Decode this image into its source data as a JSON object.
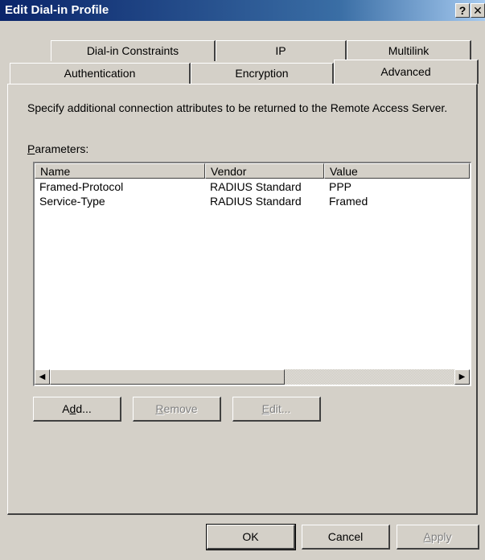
{
  "window": {
    "title": "Edit Dial-in Profile",
    "help_label": "?",
    "close_label": "✕"
  },
  "tabs": {
    "back": [
      "Dial-in Constraints",
      "IP",
      "Multilink"
    ],
    "front": [
      "Authentication",
      "Encryption",
      "Advanced"
    ],
    "active": "Advanced"
  },
  "advanced": {
    "description": "Specify additional connection attributes to be returned to the Remote Access Server.",
    "parameters_label": "Parameters:",
    "columns": {
      "name": "Name",
      "vendor": "Vendor",
      "value": "Value"
    },
    "rows": [
      {
        "name": "Framed-Protocol",
        "vendor": "RADIUS Standard",
        "value": "PPP"
      },
      {
        "name": "Service-Type",
        "vendor": "RADIUS Standard",
        "value": "Framed"
      }
    ],
    "scroll_left": "◀",
    "scroll_right": "▶",
    "buttons": {
      "add": "Add...",
      "remove": "Remove",
      "edit": "Edit..."
    }
  },
  "footer": {
    "ok": "OK",
    "cancel": "Cancel",
    "apply": "Apply"
  }
}
